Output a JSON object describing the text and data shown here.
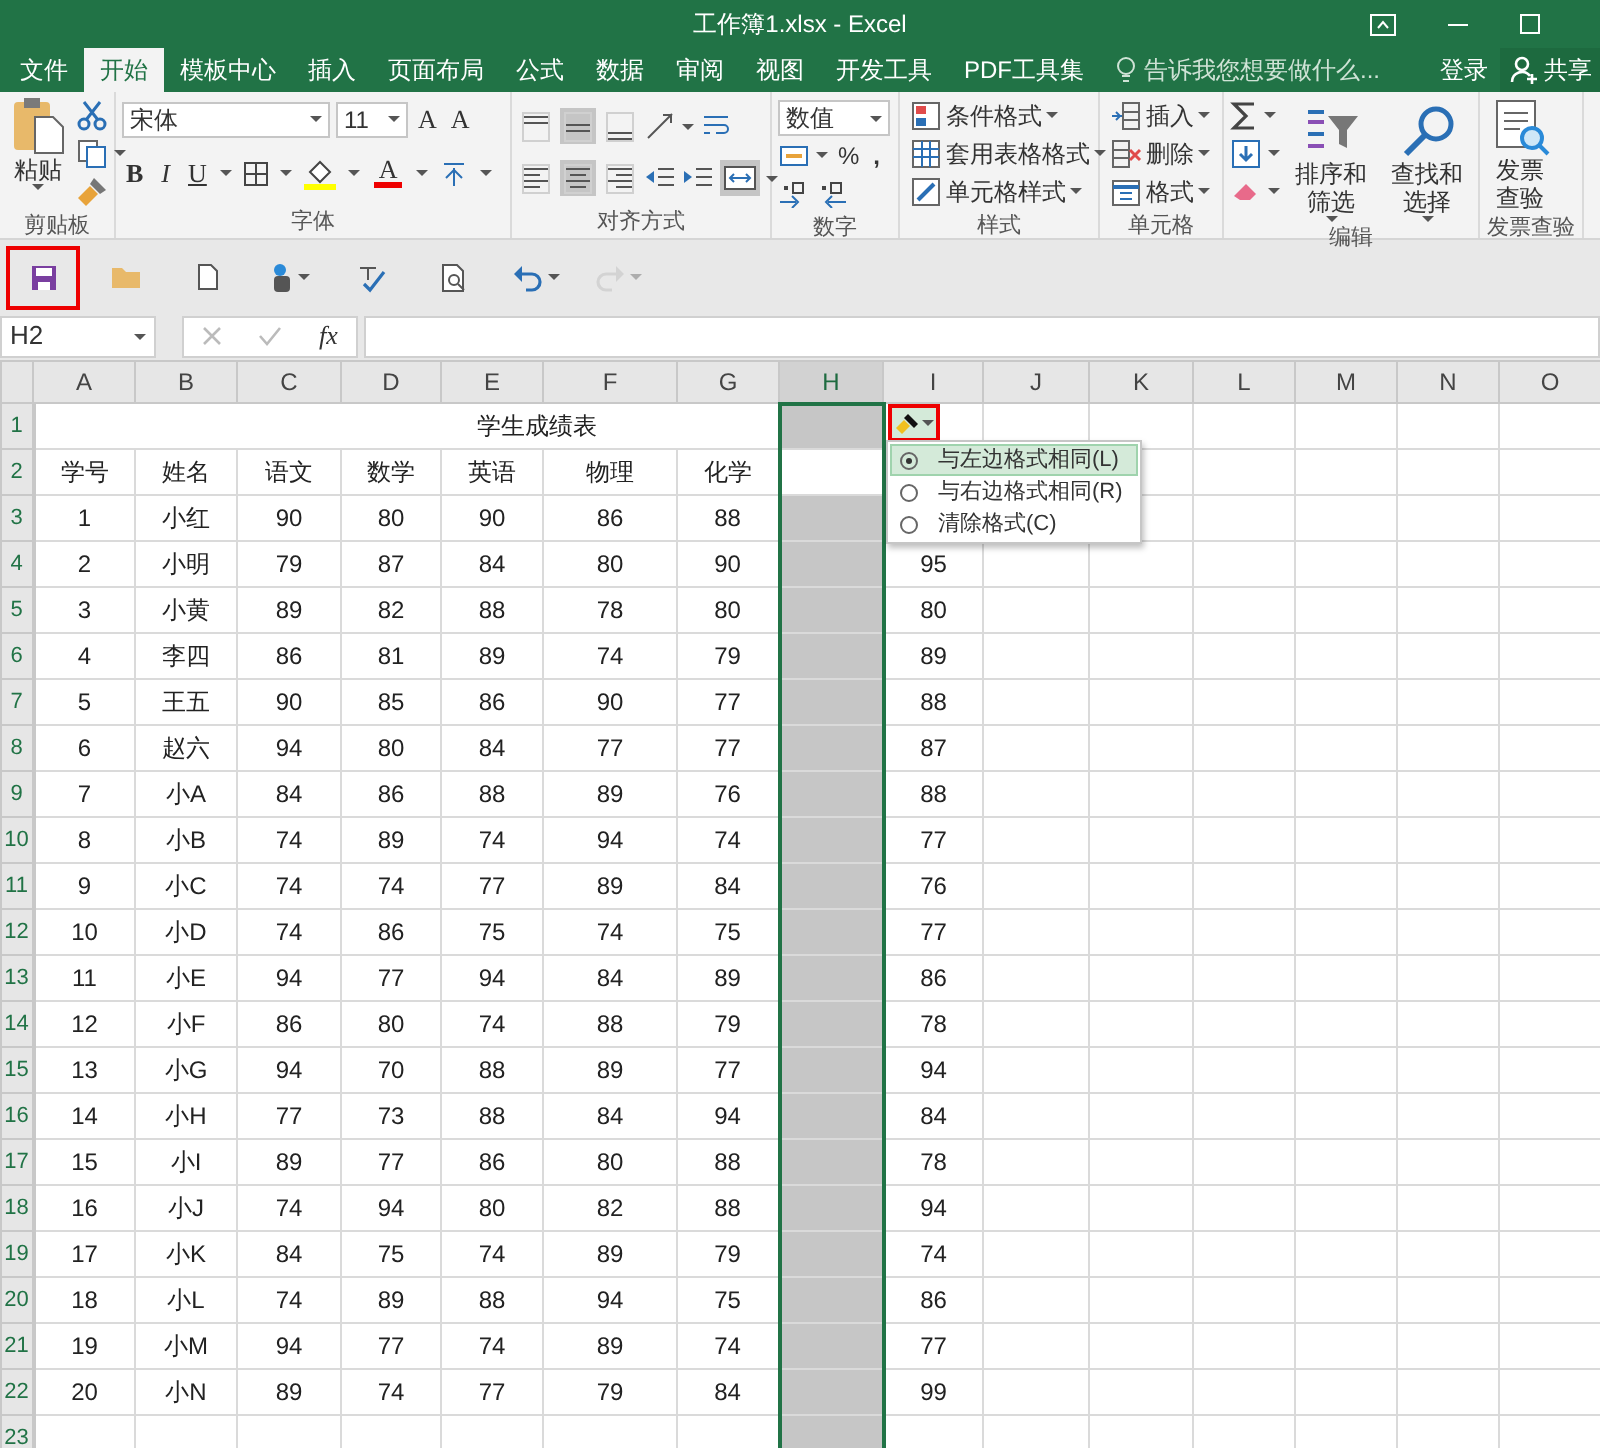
{
  "window": {
    "title": "工作簿1.xlsx - Excel"
  },
  "ribbon_tabs": [
    {
      "label": "文件",
      "selected": false
    },
    {
      "label": "开始",
      "selected": true
    },
    {
      "label": "模板中心",
      "selected": false
    },
    {
      "label": "插入",
      "selected": false
    },
    {
      "label": "页面布局",
      "selected": false
    },
    {
      "label": "公式",
      "selected": false
    },
    {
      "label": "数据",
      "selected": false
    },
    {
      "label": "审阅",
      "selected": false
    },
    {
      "label": "视图",
      "selected": false
    },
    {
      "label": "开发工具",
      "selected": false
    },
    {
      "label": "PDF工具集",
      "selected": false
    }
  ],
  "tell_me": {
    "placeholder": "告诉我您想要做什么..."
  },
  "sign_in": "登录",
  "share": "共享",
  "ribbon": {
    "clipboard": {
      "label": "剪贴板",
      "paste": "粘贴"
    },
    "font": {
      "label": "字体",
      "font_name": "宋体",
      "font_size": "11",
      "grow": "A",
      "shrink": "A",
      "bold": "B",
      "italic": "I",
      "underline": "U",
      "font_color": "A"
    },
    "alignment": {
      "label": "对齐方式",
      "vertical": [
        {
          "kind": "top",
          "selected": false
        },
        {
          "kind": "middle",
          "selected": true
        },
        {
          "kind": "bottom",
          "selected": false
        }
      ],
      "horizontal": [
        {
          "kind": "left",
          "selected": false
        },
        {
          "kind": "center",
          "selected": true
        },
        {
          "kind": "right",
          "selected": false
        }
      ],
      "merge": {
        "selected": true
      }
    },
    "number": {
      "label": "数字",
      "format": "数值",
      "percent": "%",
      "comma": ","
    },
    "styles": {
      "label": "样式",
      "buttons": [
        {
          "kind": "conditional",
          "label": "条件格式"
        },
        {
          "kind": "table",
          "label": "套用表格格式"
        },
        {
          "kind": "cell",
          "label": "单元格样式"
        }
      ]
    },
    "cells": {
      "label": "单元格",
      "buttons": [
        {
          "kind": "insert",
          "label": "插入"
        },
        {
          "kind": "delete",
          "label": "删除"
        },
        {
          "kind": "format",
          "label": "格式"
        }
      ]
    },
    "editing": {
      "label": "编辑",
      "sort": "排序和筛选",
      "find": "查找和选择"
    },
    "invoice": {
      "label": "发票查验",
      "button": "发票查验"
    }
  },
  "quick_access": [
    {
      "kind": "save",
      "highlighted": true,
      "disabled": false
    },
    {
      "kind": "open",
      "highlighted": false,
      "disabled": false
    },
    {
      "kind": "new",
      "highlighted": false,
      "disabled": false
    },
    {
      "kind": "touch",
      "highlighted": false,
      "disabled": false
    },
    {
      "kind": "spelling",
      "highlighted": false,
      "disabled": false
    },
    {
      "kind": "preview",
      "highlighted": false,
      "disabled": false
    },
    {
      "kind": "undo",
      "highlighted": false,
      "disabled": false
    },
    {
      "kind": "redo",
      "highlighted": false,
      "disabled": true
    }
  ],
  "formula_bar": {
    "name_box": "H2",
    "function_label": "fx"
  },
  "sheet": {
    "columns": [
      {
        "label": "A",
        "selected": false
      },
      {
        "label": "B",
        "selected": false
      },
      {
        "label": "C",
        "selected": false
      },
      {
        "label": "D",
        "selected": false
      },
      {
        "label": "E",
        "selected": false
      },
      {
        "label": "F",
        "selected": false
      },
      {
        "label": "G",
        "selected": false
      },
      {
        "label": "H",
        "selected": true
      },
      {
        "label": "I",
        "selected": false
      },
      {
        "label": "J",
        "selected": false
      },
      {
        "label": "K",
        "selected": false
      },
      {
        "label": "L",
        "selected": false
      },
      {
        "label": "M",
        "selected": false
      },
      {
        "label": "N",
        "selected": false
      },
      {
        "label": "O",
        "selected": false
      }
    ],
    "row_numbers": [
      "1",
      "2",
      "3",
      "4",
      "5",
      "6",
      "7",
      "8",
      "9",
      "10",
      "11",
      "12",
      "13",
      "14",
      "15",
      "16",
      "17",
      "18",
      "19",
      "20",
      "21",
      "22",
      "23"
    ],
    "title": "学生成绩表",
    "header": [
      "学号",
      "姓名",
      "语文",
      "数学",
      "英语",
      "物理",
      "化学"
    ],
    "rows": [
      {
        "cells": [
          "1",
          "小红",
          "90",
          "80",
          "90",
          "86",
          "88"
        ]
      },
      {
        "cells": [
          "2",
          "小明",
          "79",
          "87",
          "84",
          "80",
          "90"
        ],
        "column_i": "95"
      },
      {
        "cells": [
          "3",
          "小黄",
          "89",
          "82",
          "88",
          "78",
          "80"
        ],
        "column_i": "80"
      },
      {
        "cells": [
          "4",
          "李四",
          "86",
          "81",
          "89",
          "74",
          "79"
        ],
        "column_i": "89"
      },
      {
        "cells": [
          "5",
          "王五",
          "90",
          "85",
          "86",
          "90",
          "77"
        ],
        "column_i": "88"
      },
      {
        "cells": [
          "6",
          "赵六",
          "94",
          "80",
          "84",
          "77",
          "77"
        ],
        "column_i": "87"
      },
      {
        "cells": [
          "7",
          "小A",
          "84",
          "86",
          "88",
          "89",
          "76"
        ],
        "column_i": "88"
      },
      {
        "cells": [
          "8",
          "小B",
          "74",
          "89",
          "74",
          "94",
          "74"
        ],
        "column_i": "77"
      },
      {
        "cells": [
          "9",
          "小C",
          "74",
          "74",
          "77",
          "89",
          "84"
        ],
        "column_i": "76"
      },
      {
        "cells": [
          "10",
          "小D",
          "74",
          "86",
          "75",
          "74",
          "75"
        ],
        "column_i": "77"
      },
      {
        "cells": [
          "11",
          "小E",
          "94",
          "77",
          "94",
          "84",
          "89"
        ],
        "column_i": "86"
      },
      {
        "cells": [
          "12",
          "小F",
          "86",
          "80",
          "74",
          "88",
          "79"
        ],
        "column_i": "78"
      },
      {
        "cells": [
          "13",
          "小G",
          "94",
          "70",
          "88",
          "89",
          "77"
        ],
        "column_i": "94"
      },
      {
        "cells": [
          "14",
          "小H",
          "77",
          "73",
          "88",
          "84",
          "94"
        ],
        "column_i": "84"
      },
      {
        "cells": [
          "15",
          "小I",
          "89",
          "77",
          "86",
          "80",
          "88"
        ],
        "column_i": "78"
      },
      {
        "cells": [
          "16",
          "小J",
          "74",
          "94",
          "80",
          "82",
          "88"
        ],
        "column_i": "94"
      },
      {
        "cells": [
          "17",
          "小K",
          "84",
          "75",
          "74",
          "89",
          "79"
        ],
        "column_i": "74"
      },
      {
        "cells": [
          "18",
          "小L",
          "74",
          "89",
          "88",
          "94",
          "75"
        ],
        "column_i": "86"
      },
      {
        "cells": [
          "19",
          "小M",
          "94",
          "77",
          "74",
          "89",
          "74"
        ],
        "column_i": "77"
      },
      {
        "cells": [
          "20",
          "小N",
          "89",
          "74",
          "77",
          "79",
          "84"
        ],
        "column_i": "99"
      }
    ]
  },
  "paste_options": {
    "highlighted": true,
    "menu": [
      {
        "label": "与左边格式相同(L)",
        "selected": true
      },
      {
        "label": "与右边格式相同(R)",
        "selected": false
      },
      {
        "label": "清除格式(C)",
        "selected": false
      }
    ]
  }
}
